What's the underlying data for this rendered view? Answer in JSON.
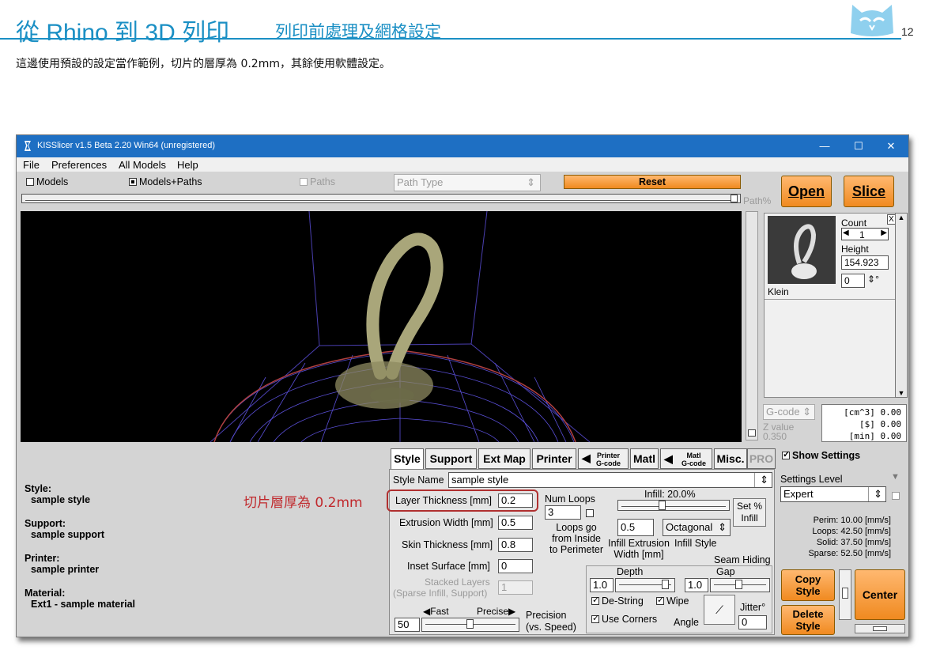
{
  "slide": {
    "title": "從 Rhino 到 3D 列印",
    "subtitle": "列印前處理及網格設定",
    "page_number": "12",
    "intro": "這邊使用預設的設定當作範例，切片的層厚為 0.2mm，其餘使用軟體設定。",
    "annotation": "切片層厚為 0.2mm",
    "accent_color": "#1a8fc4",
    "annotation_color": "#c0282c"
  },
  "window": {
    "title": "KISSlicer v1.5 Beta 2.20 Win64 (unregistered)",
    "controls": [
      "—",
      "☐",
      "✕"
    ],
    "titlebar_color": "#1e6fc3"
  },
  "menu": [
    "File",
    "Preferences",
    "All Models",
    "Help"
  ],
  "toolbar": {
    "models": "Models",
    "models_paths": "Models+Paths",
    "paths": "Paths",
    "path_type": "Path Type",
    "reset": "Reset",
    "path_pct": "Path%",
    "open": "Open",
    "slice": "Slice"
  },
  "model_panel": {
    "count_label": "Count",
    "count_value": "1",
    "height_label": "Height",
    "height_value": "154.923",
    "rotation_value": "0",
    "degree": "°",
    "model_name": "Klein",
    "close": "X"
  },
  "stats": {
    "gcode": "G-code",
    "z_label": "Z value",
    "z_value": "0.350",
    "volume": "[cm^3]  0.00",
    "cost": "[$]  0.00",
    "time": "[min]  0.00"
  },
  "summary": {
    "style_label": "Style:",
    "style_value": "sample style",
    "support_label": "Support:",
    "support_value": "sample support",
    "printer_label": "Printer:",
    "printer_value": "sample printer",
    "material_label": "Material:",
    "material_value": "Ext1 - sample material"
  },
  "tabs": {
    "style": "Style",
    "support": "Support",
    "ext_map": "Ext Map",
    "printer": "Printer",
    "printer_gcode_1": "Printer",
    "printer_gcode_2": "G-code",
    "matl": "Matl",
    "matl_gcode_1": "Matl",
    "matl_gcode_2": "G-code",
    "misc": "Misc.",
    "pro": "PRO"
  },
  "style_panel": {
    "style_name_label": "Style Name",
    "style_name_value": "sample style",
    "layer_thickness_label": "Layer Thickness [mm]",
    "layer_thickness_value": "0.2",
    "extrusion_width_label": "Extrusion Width [mm]",
    "extrusion_width_value": "0.5",
    "skin_thickness_label": "Skin Thickness [mm]",
    "skin_thickness_value": "0.8",
    "inset_surface_label": "Inset  Surface [mm]",
    "inset_surface_value": "0",
    "stacked_layers_1": "Stacked Layers",
    "stacked_layers_2": "(Sparse Infill, Support)",
    "stacked_layers_value": "1",
    "num_loops_label": "Num Loops",
    "num_loops_value": "3",
    "loops_go_1": "Loops go",
    "loops_go_2": "from Inside",
    "loops_go_3": "to Perimeter",
    "infill_label": "Infill: 20.0%",
    "set_infill_1": "Set %",
    "set_infill_2": "Infill",
    "infill_width_value": "0.5",
    "infill_width_label_1": "Infill Extrusion",
    "infill_width_label_2": "Width [mm]",
    "infill_style_value": "Octagonal",
    "infill_style_label": "Infill Style",
    "seam_hiding": "Seam Hiding",
    "depth_label": "Depth",
    "depth_value": "1.0",
    "gap_label": "Gap",
    "gap_value": "1.0",
    "destring": "De-String",
    "wipe": "Wipe",
    "use_corners": "Use Corners",
    "angle": "Angle",
    "jitter_label": "Jitter°",
    "jitter_value": "0",
    "fast": "Fast",
    "precise": "Precise",
    "precision_value": "50",
    "precision_1": "Precision",
    "precision_2": "(vs. Speed)"
  },
  "right_panel": {
    "show_settings": "Show Settings",
    "settings_level_label": "Settings Level",
    "settings_level_value": "Expert",
    "perim": "Perim:  10.00 [mm/s]",
    "loops": "Loops:  42.50 [mm/s]",
    "solid": "Solid:  37.50 [mm/s]",
    "sparse": "Sparse: 52.50 [mm/s]",
    "copy_style_1": "Copy",
    "copy_style_2": "Style",
    "delete_style_1": "Delete",
    "delete_style_2": "Style",
    "center": "Center"
  }
}
